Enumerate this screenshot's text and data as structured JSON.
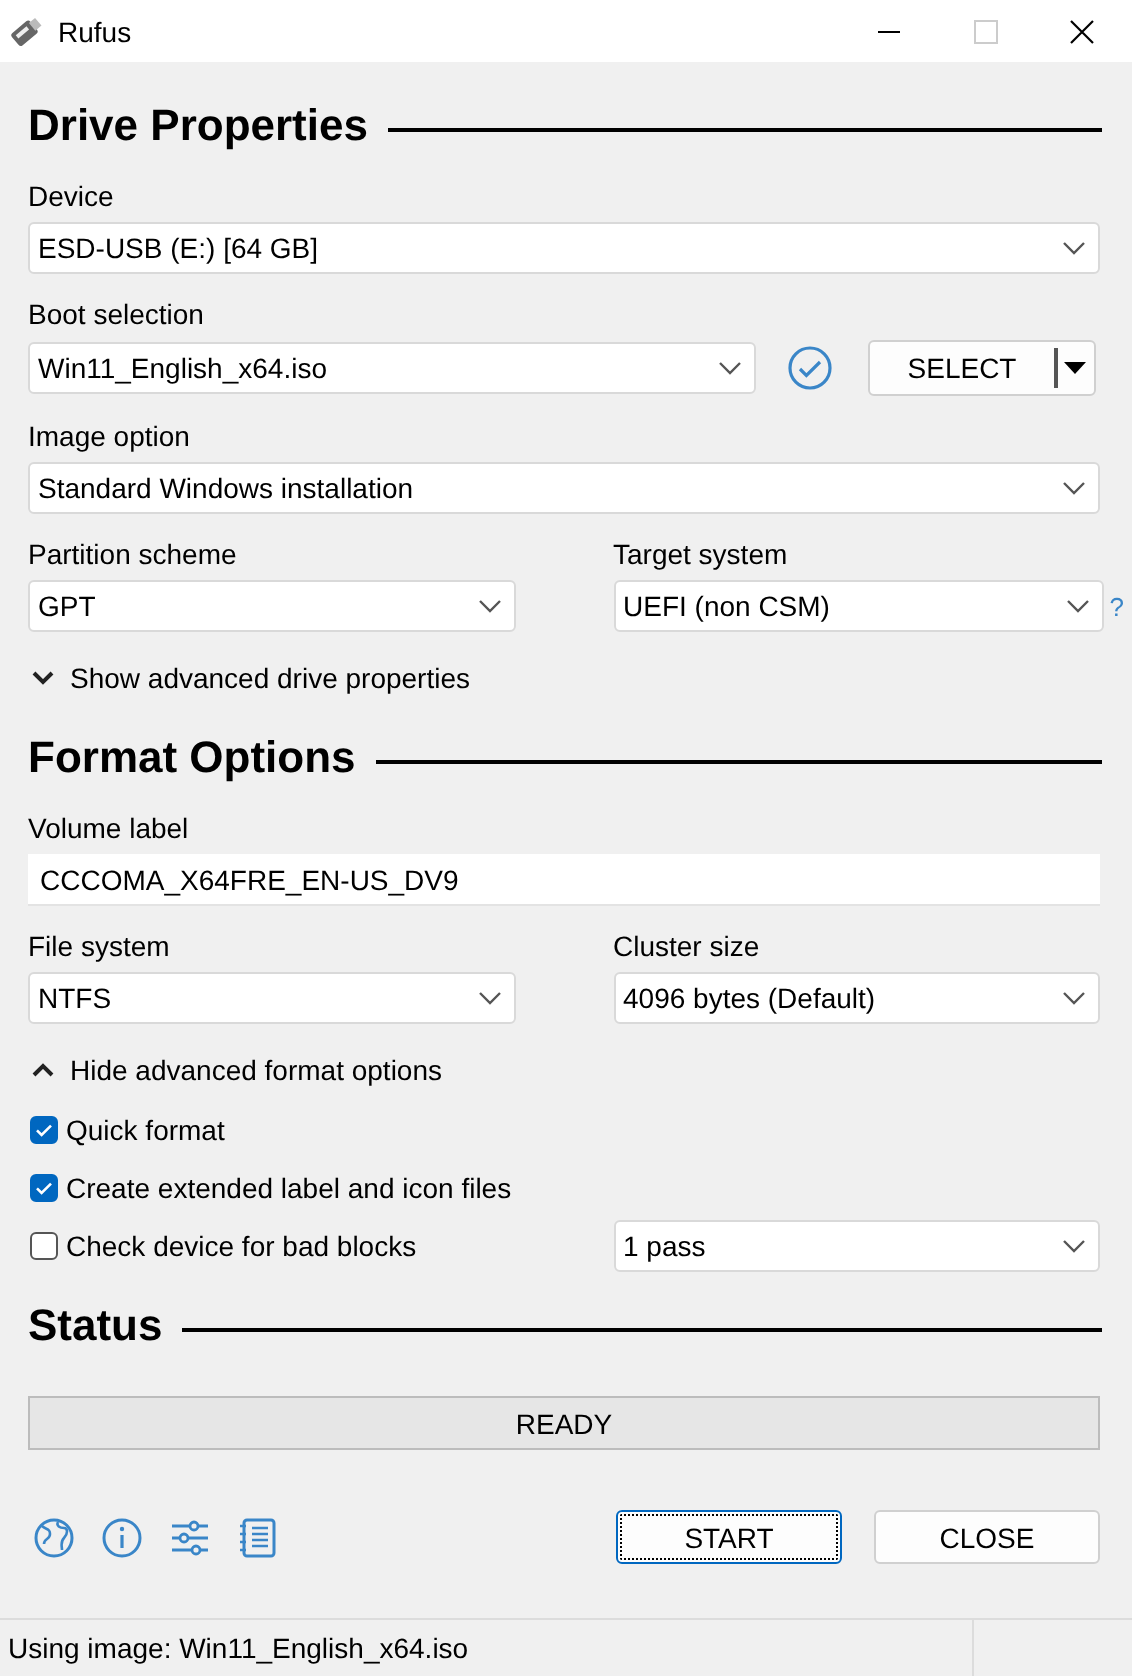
{
  "window": {
    "title": "Rufus"
  },
  "sections": [
    {
      "title": "Drive Properties",
      "rows": [
        {
          "kind": "select",
          "label": "Device",
          "value": "ESD-USB (E:) [64 GB]"
        },
        {
          "kind": "boot",
          "label": "Boot selection",
          "value": "Win11_English_x64.iso",
          "button": "SELECT"
        },
        {
          "kind": "select",
          "label": "Image option",
          "value": "Standard Windows installation"
        },
        {
          "kind": "pair",
          "fields": [
            {
              "label": "Partition scheme",
              "value": "GPT"
            },
            {
              "label": "Target system",
              "value": "UEFI (non CSM)",
              "help": "?"
            }
          ]
        },
        {
          "kind": "toggle",
          "label": "Show advanced drive properties",
          "expanded": false
        }
      ]
    },
    {
      "title": "Format Options",
      "rows": [
        {
          "kind": "input",
          "label": "Volume label",
          "value": "CCCOMA_X64FRE_EN-US_DV9"
        },
        {
          "kind": "pair",
          "fields": [
            {
              "label": "File system",
              "value": "NTFS"
            },
            {
              "label": "Cluster size",
              "value": "4096 bytes (Default)"
            }
          ]
        },
        {
          "kind": "toggle",
          "label": "Hide advanced format options",
          "expanded": true
        },
        {
          "kind": "checkbox",
          "label": "Quick format",
          "checked": true
        },
        {
          "kind": "checkbox",
          "label": "Create extended label and icon files",
          "checked": true
        },
        {
          "kind": "checkbox",
          "label": "Check device for bad blocks",
          "checked": false,
          "select": "1 pass"
        }
      ]
    },
    {
      "title": "Status",
      "rows": [
        {
          "kind": "progress",
          "text": "READY"
        }
      ]
    }
  ],
  "buttons": [
    {
      "label": "START",
      "focused": true
    },
    {
      "label": "CLOSE",
      "focused": false
    }
  ],
  "status_bar": "Using image: Win11_English_x64.iso"
}
